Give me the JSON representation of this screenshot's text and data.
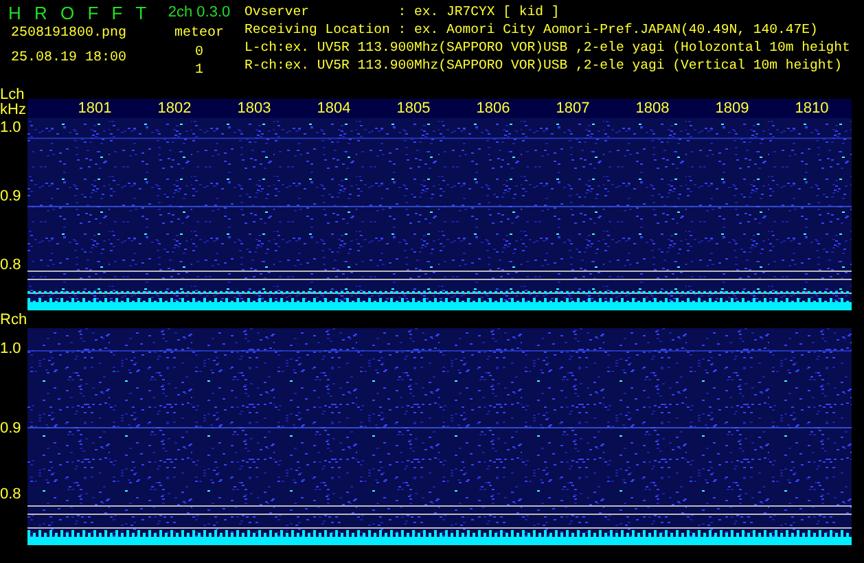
{
  "header": {
    "app_title": "H R O F F T",
    "version": "2ch 0.3.0",
    "file_name": "2508191800.png",
    "timestamp": "25.08.19 18:00",
    "meteor_label": "meteor",
    "meteor_counts": [
      "0",
      "1"
    ],
    "info_lines": [
      "Ovserver           : ex. JR7CYX [ kid ]",
      "Receiving Location : ex. Aomori City Aomori-Pref.JAPAN(40.49N, 140.47E)",
      "L-ch:ex. UV5R 113.900Mhz(SAPPORO VOR)USB ,2-ele yagi (Holozontal 10m height",
      "R-ch:ex. UV5R 113.900Mhz(SAPPORO VOR)USB ,2-ele yagi (Vertical 10m height)"
    ]
  },
  "x_axis": {
    "labels": [
      "1801",
      "1802",
      "1803",
      "1804",
      "1805",
      "1806",
      "1807",
      "1808",
      "1809",
      "1810"
    ]
  },
  "channels": [
    {
      "name": "Lch",
      "unit": "kHz",
      "y_labels": [
        "1.0",
        "0.9",
        "0.8"
      ]
    },
    {
      "name": "Rch",
      "y_labels": [
        "1.0",
        "0.9",
        "0.8"
      ]
    }
  ]
}
